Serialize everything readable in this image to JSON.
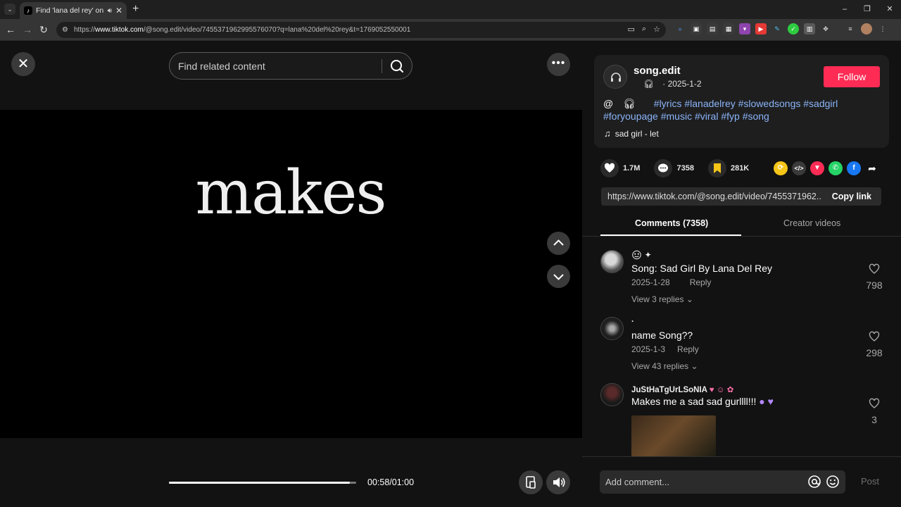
{
  "browser": {
    "tab_title": "Find 'lana del rey' on TikTok",
    "favicon": "tiktok-icon",
    "new_tab": "+",
    "url_prefix": "https://",
    "url_host": "www.tiktok.com",
    "url_path": "/@song.edit/video/7455371962995576070?q=lana%20del%20rey&t=1769052550001",
    "window_controls": [
      "–",
      "❐",
      "✕"
    ],
    "extension_icons": [
      "translate-icon",
      "reader-icon",
      "photos-icon",
      "briefcase-icon",
      "bookmark-purple-icon",
      "youtube-icon",
      "twitch-icon",
      "scissors-icon",
      "green-circle-icon",
      "grid-icon",
      "puzzle-icon",
      "playlist-icon",
      "profile-avatar",
      "menu-icon"
    ]
  },
  "video": {
    "search_placeholder": "Find related content",
    "caption_word": "makes",
    "time_display": "00:58/01:00",
    "progress_fraction": 0.967
  },
  "post": {
    "author": "song.edit",
    "date": "· 2025-1-2",
    "follow_label": "Follow",
    "desc_prefix": "@",
    "hashtags": [
      "#lyrics",
      "#lanadelrey",
      "#slowedsongs",
      "#sadgirl",
      "#foryoupage",
      "#music",
      "#viral",
      "#fyp",
      "#song"
    ],
    "music": "sad girl - let",
    "likes": "1.7M",
    "comments": "7358",
    "saves": "281K",
    "share_icons": [
      {
        "name": "repost-icon",
        "color": "#f5c518"
      },
      {
        "name": "embed-icon",
        "color": "#3a3a3a"
      },
      {
        "name": "send-icon",
        "color": "#fe2c55"
      },
      {
        "name": "whatsapp-icon",
        "color": "#25d366"
      },
      {
        "name": "facebook-icon",
        "color": "#1877f2"
      }
    ],
    "link": "https://www.tiktok.com/@song.edit/video/7455371962...",
    "copy_link_label": "Copy link"
  },
  "tabs": {
    "comments": "Comments (7358)",
    "creator_videos": "Creator videos"
  },
  "comments": [
    {
      "user": "",
      "text": "Song: Sad Girl By Lana Del Rey",
      "date": "2025-1-28",
      "reply": "Reply",
      "replies": "View 3 replies",
      "likes": "798"
    },
    {
      "user": ".",
      "text": "name Song??",
      "date": "2025-1-3",
      "reply": "Reply",
      "replies": "View 43 replies",
      "likes": "298"
    },
    {
      "user": "JuStHaTgUrLSoNIA",
      "text": "Makes me a sad sad gurllll!!!",
      "likes": "3"
    }
  ],
  "comment_bar": {
    "placeholder": "Add comment...",
    "post_label": "Post"
  }
}
